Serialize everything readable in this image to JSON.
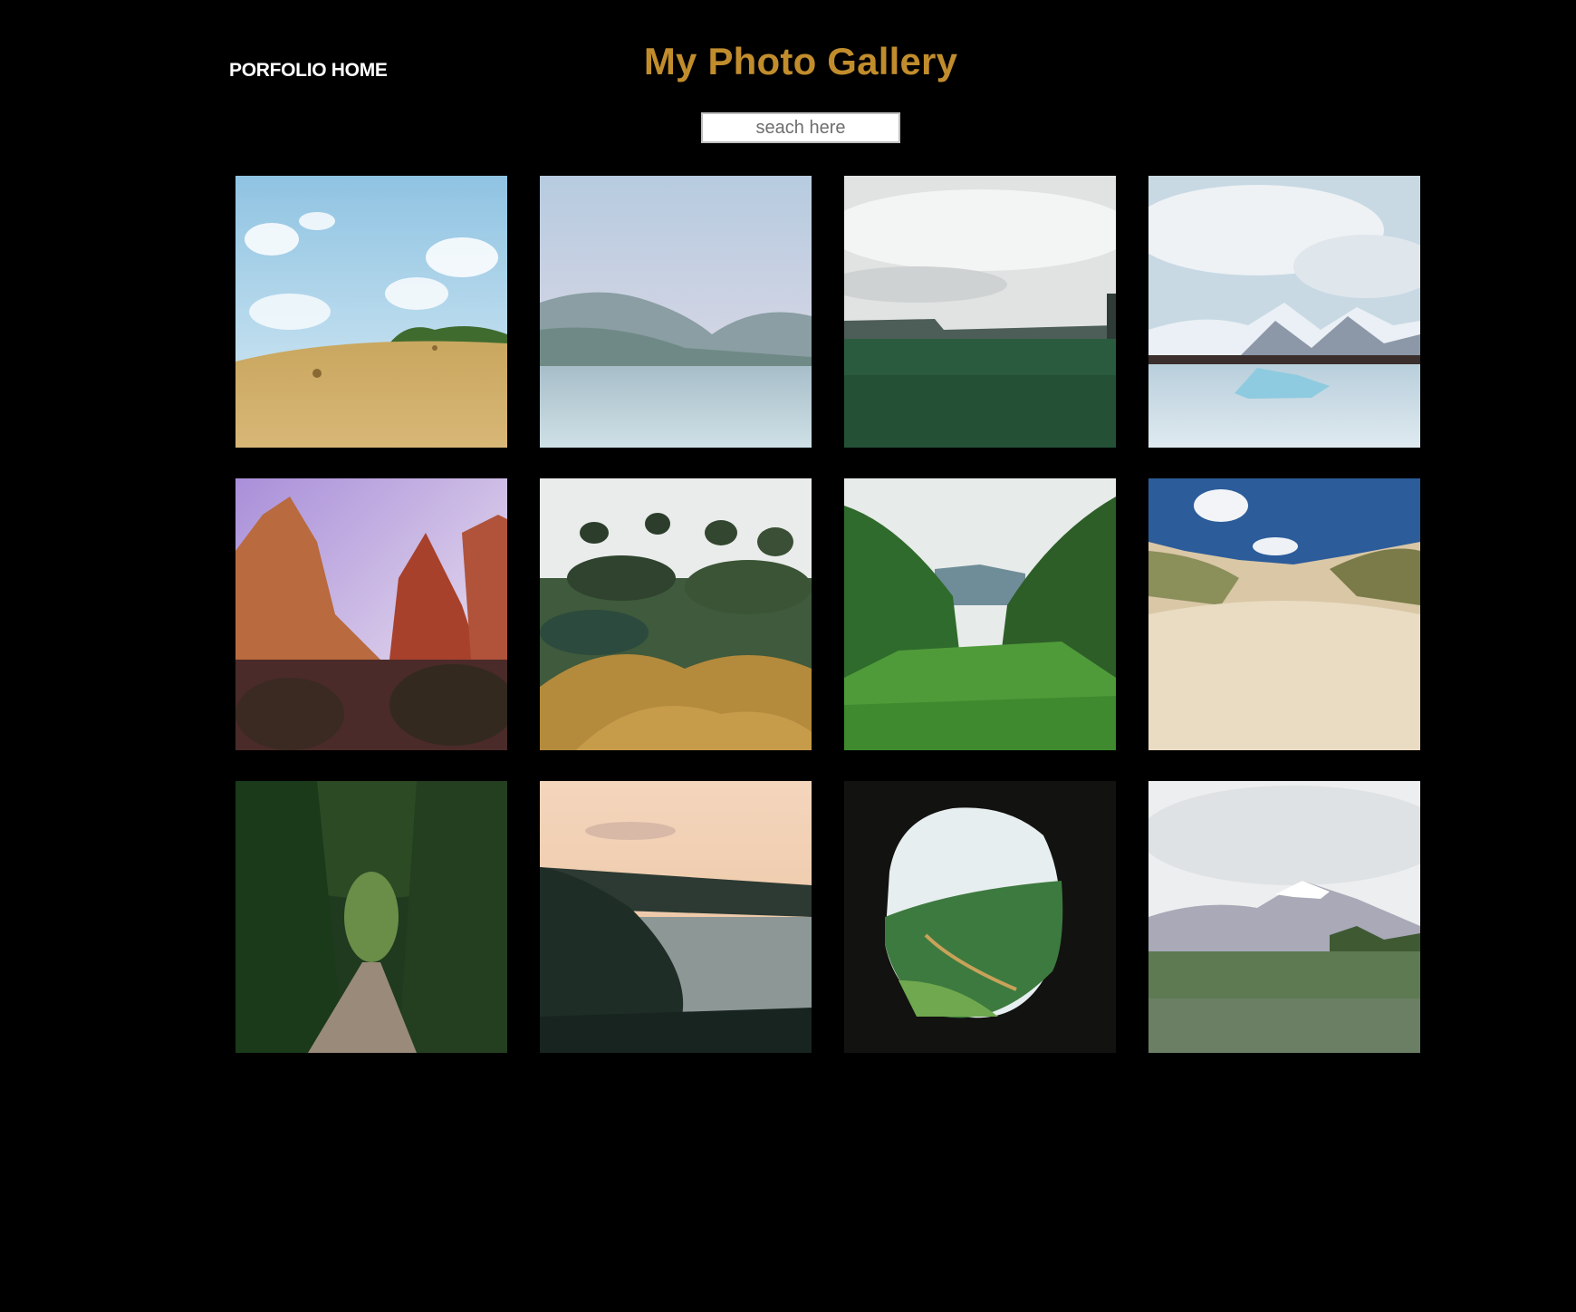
{
  "header": {
    "home_label": "PORFOLIO HOME",
    "title": "My Photo Gallery"
  },
  "search": {
    "placeholder": "seach here"
  },
  "colors": {
    "background": "#000000",
    "title": "#c18d2c",
    "home_link": "#ffffff"
  },
  "gallery": {
    "columns": 4,
    "rows": 3,
    "photos": [
      {
        "subject": "wheat field with hay bales under blue sky"
      },
      {
        "subject": "calm lake with misty mountains"
      },
      {
        "subject": "green meadow under cloudy sky"
      },
      {
        "subject": "glacier lagoon with icebergs and snowy peaks"
      },
      {
        "subject": "red rock canyon cliffs"
      },
      {
        "subject": "garden with shaped pine trees"
      },
      {
        "subject": "lush green valley with tall grass"
      },
      {
        "subject": "sand dunes with beach grass"
      },
      {
        "subject": "tree tunnel over a path"
      },
      {
        "subject": "sunset over coastal cliffs"
      },
      {
        "subject": "view from cave over green valley"
      },
      {
        "subject": "snowy mountain behind lupine meadow"
      }
    ]
  }
}
